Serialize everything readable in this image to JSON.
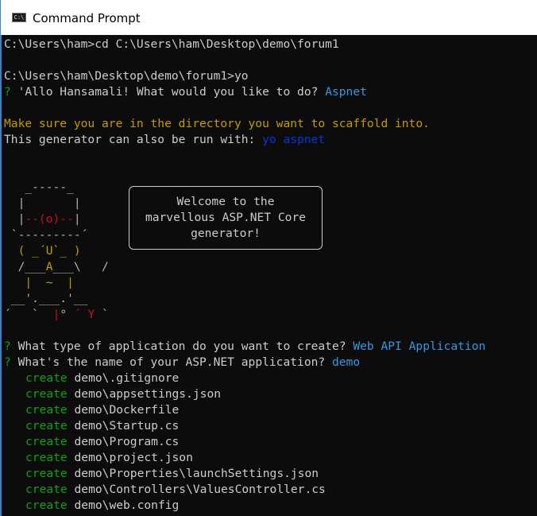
{
  "window": {
    "title": "Command Prompt",
    "icon": "C:\\"
  },
  "colors": {
    "background": "#0c0c0c",
    "text": "#cccccc",
    "prompt_mark": "#13a10e",
    "answer": "#3a96dd",
    "warning": "#c19c00",
    "link": "#0037da",
    "create": "#13a10e",
    "title_border": "#3c83c4"
  },
  "console": {
    "line1": "C:\\Users\\ham>cd C:\\Users\\ham\\Desktop\\demo\\forum1",
    "line2": "C:\\Users\\ham\\Desktop\\demo\\forum1>yo",
    "q1_mark": "?",
    "q1_text": " 'Allo Hansamali! What would you like to do? ",
    "q1_answer": "Aspnet",
    "note": "Make sure you are in the directory you want to scaffold into.",
    "alt_text": "This generator can also be run with: ",
    "alt_cmd": "yo aspnet",
    "welcome": [
      "Welcome to the",
      "marvellous ASP.NET Core",
      "generator!"
    ],
    "art": {
      "r0": "   _-----_",
      "r1a": "  |       |",
      "r2a": "  |",
      "r2b": "--(o)--",
      "r2c": "|",
      "r3": " `---------´",
      "r4a": "  ( ",
      "r4b": "_´U`_",
      "r4c": " )",
      "r5a": "  /___",
      "r5b": "A",
      "r5c": "___\\   /",
      "r6a": "   |  ",
      "r6b": "~",
      "r6c": "  |",
      "r7a": " __'.___.'__",
      "r8a": "´   `  ",
      "r8b": "|",
      "r8c": "° ",
      "r8d": "´ Y",
      "r8e": " `"
    },
    "q2_mark": "?",
    "q2_text": " What type of application do you want to create? ",
    "q2_answer": "Web API Application",
    "q3_mark": "?",
    "q3_text": " What's the name of your ASP.NET application? ",
    "q3_answer": "demo",
    "creates": [
      {
        "verb": "create",
        "path": "demo\\.gitignore"
      },
      {
        "verb": "create",
        "path": "demo\\appsettings.json"
      },
      {
        "verb": "create",
        "path": "demo\\Dockerfile"
      },
      {
        "verb": "create",
        "path": "demo\\Startup.cs"
      },
      {
        "verb": "create",
        "path": "demo\\Program.cs"
      },
      {
        "verb": "create",
        "path": "demo\\project.json"
      },
      {
        "verb": "create",
        "path": "demo\\Properties\\launchSettings.json"
      },
      {
        "verb": "create",
        "path": "demo\\Controllers\\ValuesController.cs"
      },
      {
        "verb": "create",
        "path": "demo\\web.config"
      }
    ]
  }
}
